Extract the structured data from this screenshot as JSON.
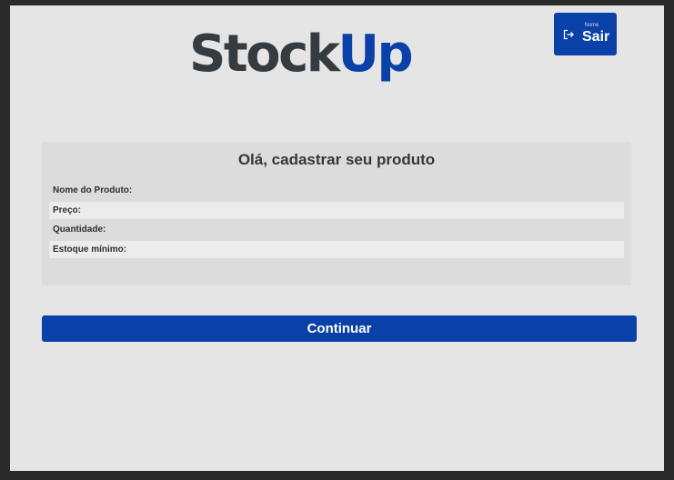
{
  "brand": {
    "part1": "Stock",
    "part2": "Up"
  },
  "logout": {
    "user_label": "Nome",
    "label": "Sair"
  },
  "form": {
    "title": "Olá, cadastrar seu produto",
    "fields": [
      {
        "label": "Nome do Produto:"
      },
      {
        "label": "Preço:"
      },
      {
        "label": "Quantidade:"
      },
      {
        "label": "Estoque mínimo:"
      }
    ]
  },
  "actions": {
    "continue_label": "Continuar"
  },
  "colors": {
    "accent": "#0a41a8",
    "brand_dark": "#353b3f"
  }
}
